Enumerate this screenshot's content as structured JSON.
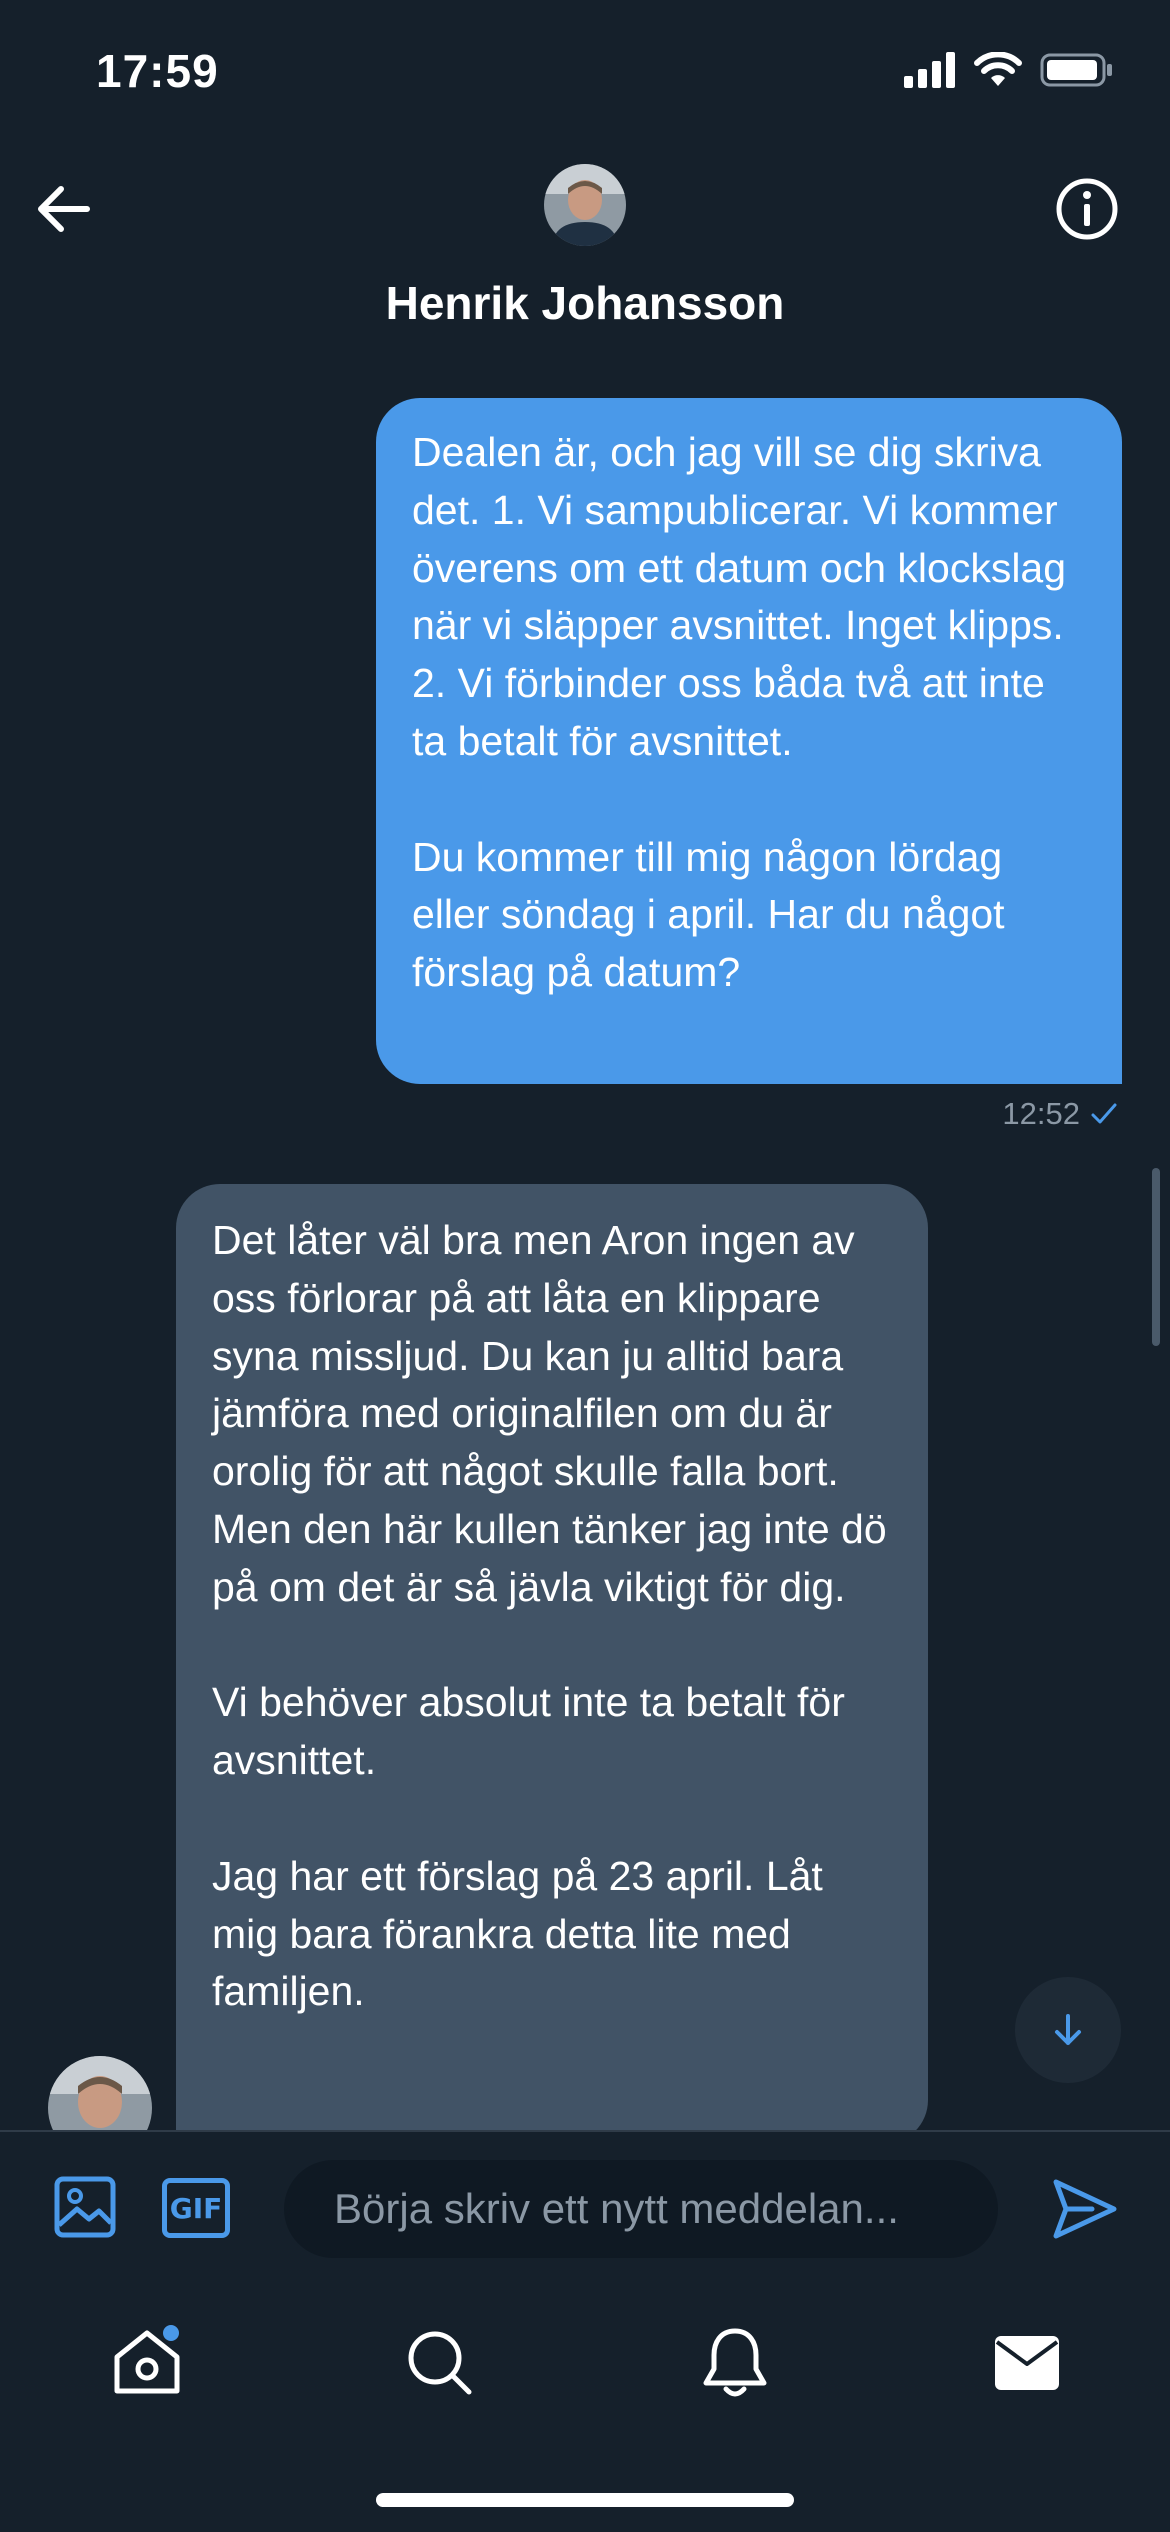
{
  "status_bar": {
    "time": "17:59"
  },
  "header": {
    "contact_name": "Henrik Johansson"
  },
  "messages": {
    "sent": {
      "text": "Dealen är, och jag vill se dig skriva det. 1. Vi sampublicerar. Vi kommer överens om ett datum och klockslag när vi släpper avsnittet. Inget klipps. 2. Vi förbinder oss båda två att inte ta betalt för avsnittet.\n\nDu kommer till mig någon lördag eller söndag i april. Har du något förslag på datum?",
      "time": "12:52"
    },
    "received": {
      "text": "Det låter väl bra men Aron ingen av oss förlorar på att låta en klippare syna missljud. Du kan ju alltid bara jämföra med originalfilen om du är orolig för att något skulle falla bort. Men den här kullen tänker jag inte dö på om det är så jävla viktigt för dig.\n\nVi behöver absolut inte ta betalt för avsnittet.\n\nJag har ett förslag på 23 april. Låt mig bara förankra detta lite med familjen."
    }
  },
  "composer": {
    "gif_label": "GIF",
    "placeholder": "Börja skriv ett nytt meddelan..."
  },
  "colors": {
    "background": "#15202b",
    "sent_bubble": "#4a99e9",
    "received_bubble": "#415366",
    "accent": "#4a99e9",
    "muted_text": "#8b98a5"
  },
  "icons": {
    "back": "arrow-left-icon",
    "info": "info-icon",
    "read_receipt": "checkmark-icon",
    "scroll_down": "arrow-down-icon",
    "media": "image-icon",
    "send": "send-icon",
    "tabs": [
      "home-icon",
      "search-icon",
      "bell-icon",
      "envelope-icon"
    ]
  },
  "tab_bar": {
    "home_has_notification_dot": true
  }
}
